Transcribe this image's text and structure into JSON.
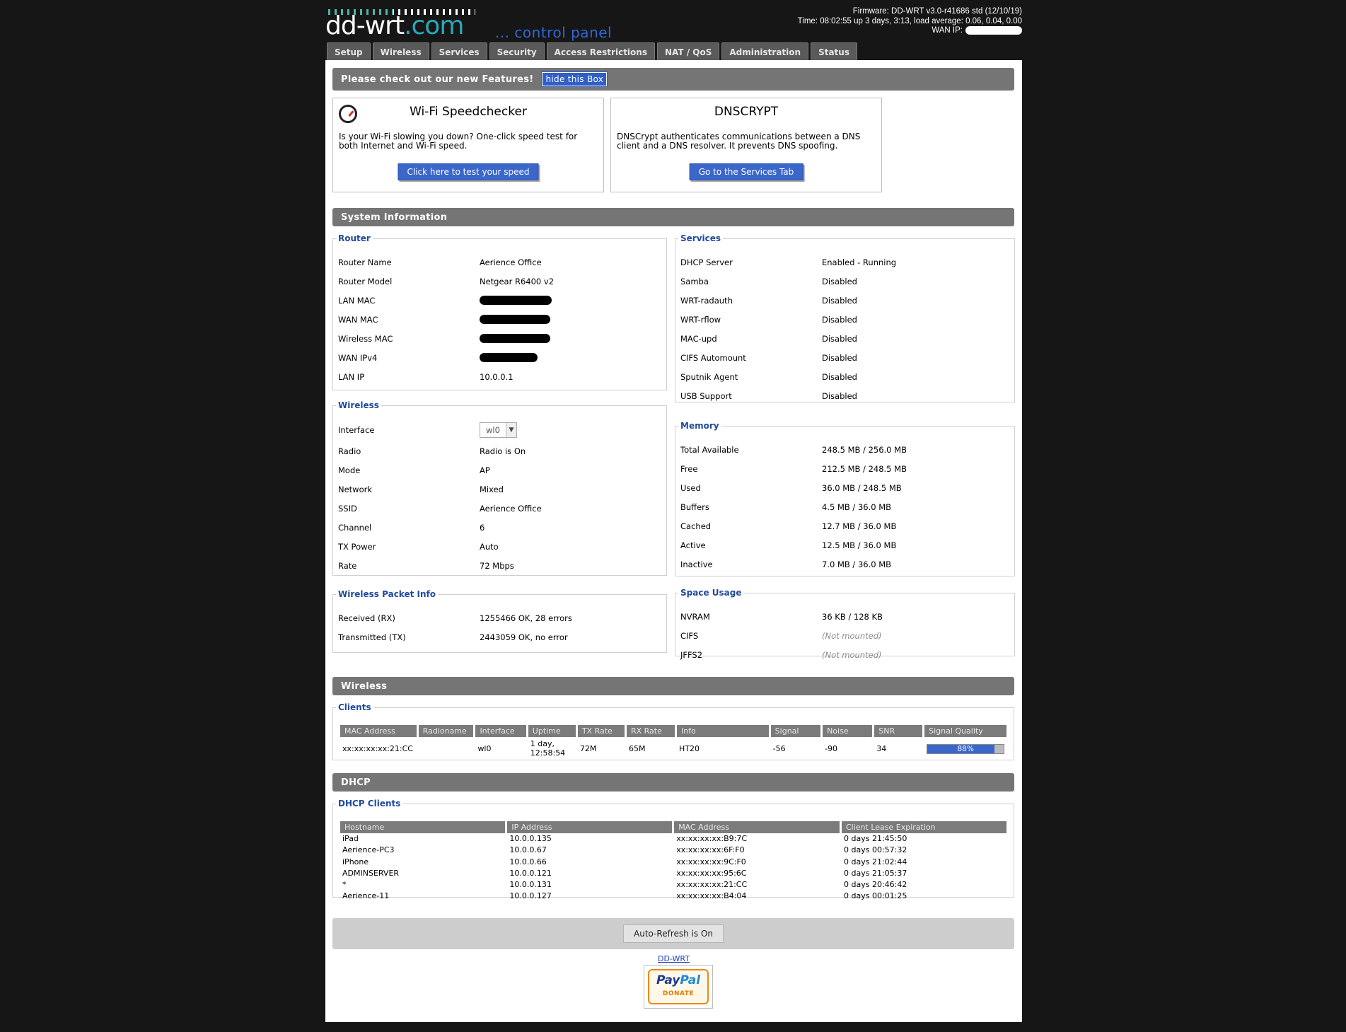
{
  "header": {
    "logo_text": "dd-wrt",
    "logo_dotcom": ".com",
    "logo_cp": "... control panel",
    "firmware": "Firmware: DD-WRT v3.0-r41686 std (12/10/19)",
    "time": "Time: 08:02:55 up 3 days, 3:13, load average: 0.06, 0.04, 0.00",
    "wan_ip_label": "WAN IP:"
  },
  "tabs": [
    "Setup",
    "Wireless",
    "Services",
    "Security",
    "Access Restrictions",
    "NAT / QoS",
    "Administration",
    "Status"
  ],
  "features": {
    "bar_title": "Please check out our new Features!",
    "hide_button": "hide this Box",
    "speed": {
      "title": "Wi-Fi Speedchecker",
      "text": "Is your Wi-Fi slowing you down? One-click speed test for both Internet and Wi-Fi speed.",
      "button": "Click here to test your speed"
    },
    "dns": {
      "title": "DNSCRYPT",
      "text": "DNSCrypt authenticates communications between a DNS client and a DNS resolver. It prevents DNS spoofing.",
      "button": "Go to the Services Tab"
    }
  },
  "system_info": {
    "title": "System Information",
    "router": {
      "legend": "Router",
      "rows": [
        {
          "k": "Router Name",
          "v": "Aerience Office"
        },
        {
          "k": "Router Model",
          "v": "Netgear R6400 v2"
        },
        {
          "k": "LAN MAC",
          "v": ""
        },
        {
          "k": "WAN MAC",
          "v": ""
        },
        {
          "k": "Wireless MAC",
          "v": ""
        },
        {
          "k": "WAN IPv4",
          "v": ""
        },
        {
          "k": "LAN IP",
          "v": "10.0.0.1"
        }
      ]
    },
    "services": {
      "legend": "Services",
      "rows": [
        {
          "k": "DHCP Server",
          "v": "Enabled - Running"
        },
        {
          "k": "Samba",
          "v": "Disabled"
        },
        {
          "k": "WRT-radauth",
          "v": "Disabled"
        },
        {
          "k": "WRT-rflow",
          "v": "Disabled"
        },
        {
          "k": "MAC-upd",
          "v": "Disabled"
        },
        {
          "k": "CIFS Automount",
          "v": "Disabled"
        },
        {
          "k": "Sputnik Agent",
          "v": "Disabled"
        },
        {
          "k": "USB Support",
          "v": "Disabled"
        }
      ]
    },
    "wireless": {
      "legend": "Wireless",
      "interface_label": "Interface",
      "interface_value": "wl0",
      "rows": [
        {
          "k": "Radio",
          "v": "Radio is On"
        },
        {
          "k": "Mode",
          "v": "AP"
        },
        {
          "k": "Network",
          "v": "Mixed"
        },
        {
          "k": "SSID",
          "v": "Aerience Office"
        },
        {
          "k": "Channel",
          "v": "6"
        },
        {
          "k": "TX Power",
          "v": "Auto"
        },
        {
          "k": "Rate",
          "v": "72 Mbps"
        }
      ]
    },
    "memory": {
      "legend": "Memory",
      "rows": [
        {
          "k": "Total Available",
          "v": "248.5 MB / 256.0 MB"
        },
        {
          "k": "Free",
          "v": "212.5 MB / 248.5 MB"
        },
        {
          "k": "Used",
          "v": "36.0 MB / 248.5 MB"
        },
        {
          "k": "Buffers",
          "v": "4.5 MB / 36.0 MB"
        },
        {
          "k": "Cached",
          "v": "12.7 MB / 36.0 MB"
        },
        {
          "k": "Active",
          "v": "12.5 MB / 36.0 MB"
        },
        {
          "k": "Inactive",
          "v": "7.0 MB / 36.0 MB"
        }
      ]
    },
    "packet": {
      "legend": "Wireless Packet Info",
      "rows": [
        {
          "k": "Received (RX)",
          "v": "1255466 OK, 28 errors"
        },
        {
          "k": "Transmitted (TX)",
          "v": "2443059 OK, no error"
        }
      ]
    },
    "space": {
      "legend": "Space Usage",
      "rows": [
        {
          "k": "NVRAM",
          "v": "36 KB / 128 KB"
        },
        {
          "k": "CIFS",
          "v": "(Not mounted)"
        },
        {
          "k": "JFFS2",
          "v": "(Not mounted)"
        }
      ]
    }
  },
  "wireless_section": {
    "title": "Wireless",
    "clients_legend": "Clients",
    "headers": [
      "MAC Address",
      "Radioname",
      "Interface",
      "Uptime",
      "TX Rate",
      "RX Rate",
      "Info",
      "Signal",
      "Noise",
      "SNR",
      "Signal Quality"
    ],
    "row": {
      "mac": "xx:xx:xx:xx:21:CC",
      "radioname": "",
      "interface": "wl0",
      "uptime_1": "1 day,",
      "uptime_2": "12:58:54",
      "tx": "72M",
      "rx": "65M",
      "info": "HT20",
      "signal": "-56",
      "noise": "-90",
      "snr": "34",
      "quality": "88%",
      "quality_fraction": 0.88
    }
  },
  "dhcp": {
    "title": "DHCP",
    "legend": "DHCP Clients",
    "headers": [
      "Hostname",
      "IP Address",
      "MAC Address",
      "Client Lease Expiration"
    ],
    "rows": [
      [
        "iPad",
        "10.0.0.135",
        "xx:xx:xx:xx:B9:7C",
        "0 days 21:45:50"
      ],
      [
        "Aerience-PC3",
        "10.0.0.67",
        "xx:xx:xx:xx:6F:F0",
        "0 days 00:57:32"
      ],
      [
        "iPhone",
        "10.0.0.66",
        "xx:xx:xx:xx:9C:F0",
        "0 days 21:02:44"
      ],
      [
        "ADMINSERVER",
        "10.0.0.121",
        "xx:xx:xx:xx:95:6C",
        "0 days 21:05:37"
      ],
      [
        "*",
        "10.0.0.131",
        "xx:xx:xx:xx:21:CC",
        "0 days 20:46:42"
      ],
      [
        "Aerience-11",
        "10.0.0.127",
        "xx:xx:xx:xx:B4:04",
        "0 days 00:01:25"
      ]
    ]
  },
  "footer": {
    "refresh": "Auto-Refresh is On",
    "link": "DD-WRT",
    "paypal_pay": "Pay",
    "paypal_pal": "Pal",
    "paypal_donate": "DONATE"
  },
  "colors": {
    "page_bg": "#161616",
    "bar_bg": "#757575",
    "accent_blue": "#3a67c9",
    "legend_blue": "#1f4a9c"
  }
}
